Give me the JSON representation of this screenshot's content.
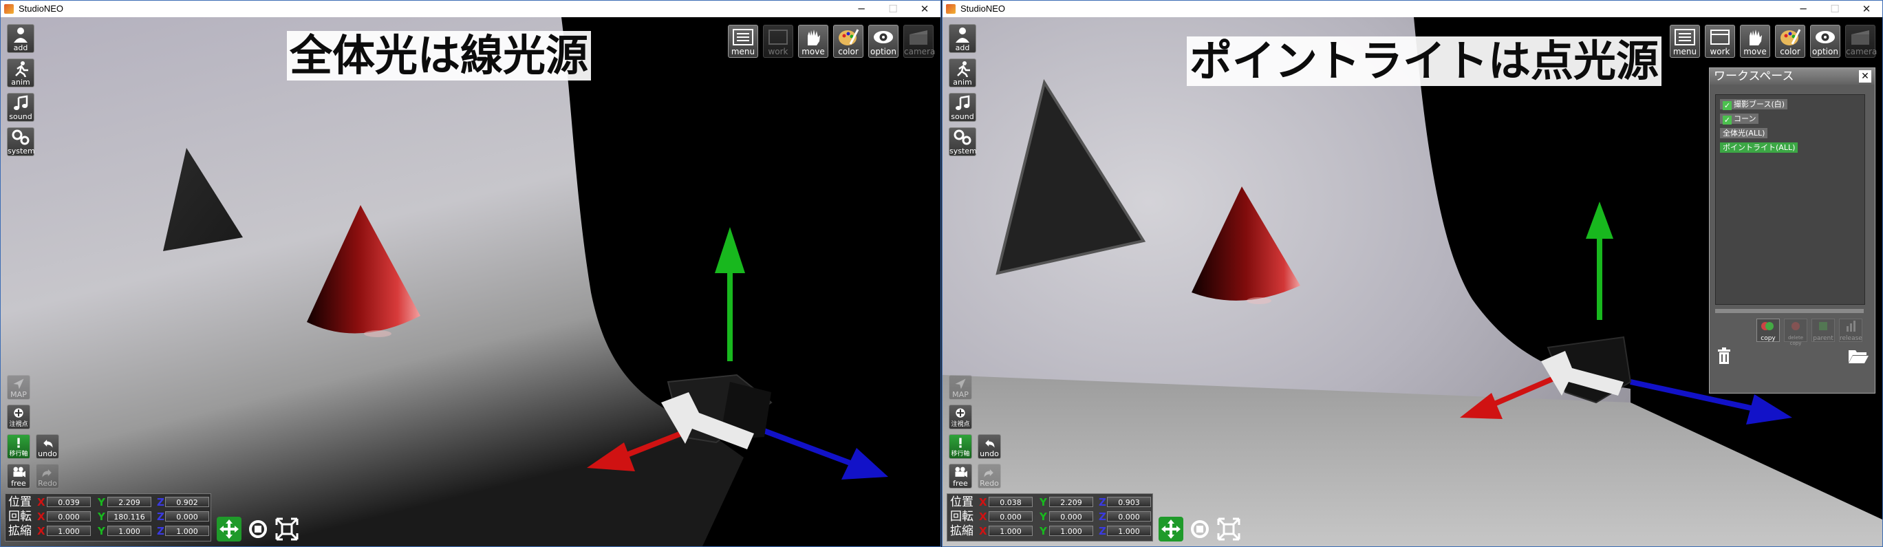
{
  "left": {
    "window_title": "StudioNEO",
    "caption": "全体光は線光源",
    "toolbar": [
      {
        "label": "menu",
        "icon": "menu-icon",
        "enabled": true
      },
      {
        "label": "work",
        "icon": "work-icon",
        "enabled": false
      },
      {
        "label": "move",
        "icon": "hand-icon",
        "enabled": true
      },
      {
        "label": "color",
        "icon": "palette-icon",
        "enabled": true
      },
      {
        "label": "option",
        "icon": "eye-icon",
        "enabled": true
      },
      {
        "label": "camera",
        "icon": "camera-icon",
        "enabled": false
      }
    ],
    "side_top": [
      {
        "label": "add",
        "icon": "person-icon"
      },
      {
        "label": "anim",
        "icon": "running-icon"
      },
      {
        "label": "sound",
        "icon": "music-note-icon"
      },
      {
        "label": "system",
        "icon": "gears-icon"
      }
    ],
    "side_bottom": {
      "map": "MAP",
      "focus": "注視点",
      "axis": "移行軸",
      "undo": "undo",
      "free": "free",
      "redo": "Redo"
    },
    "coords": [
      {
        "label": "位置",
        "x": "0.039",
        "y": "2.209",
        "z": "0.902"
      },
      {
        "label": "回転",
        "x": "0.000",
        "y": "180.116",
        "z": "0.000"
      },
      {
        "label": "拡縮",
        "x": "1.000",
        "y": "1.000",
        "z": "1.000"
      }
    ]
  },
  "right": {
    "window_title": "StudioNEO",
    "caption": "ポイントライトは点光源",
    "toolbar": [
      {
        "label": "menu",
        "icon": "menu-icon",
        "enabled": true
      },
      {
        "label": "work",
        "icon": "work-icon",
        "enabled": true
      },
      {
        "label": "move",
        "icon": "hand-icon",
        "enabled": true
      },
      {
        "label": "color",
        "icon": "palette-icon",
        "enabled": true
      },
      {
        "label": "option",
        "icon": "eye-icon",
        "enabled": true
      },
      {
        "label": "camera",
        "icon": "camera-icon",
        "enabled": false
      }
    ],
    "side_top": [
      {
        "label": "add",
        "icon": "person-icon"
      },
      {
        "label": "anim",
        "icon": "running-icon"
      },
      {
        "label": "sound",
        "icon": "music-note-icon"
      },
      {
        "label": "system",
        "icon": "gears-icon"
      }
    ],
    "side_bottom": {
      "map": "MAP",
      "focus": "注視点",
      "axis": "移行軸",
      "undo": "undo",
      "free": "free",
      "redo": "Redo"
    },
    "coords": [
      {
        "label": "位置",
        "x": "0.038",
        "y": "2.209",
        "z": "0.903"
      },
      {
        "label": "回転",
        "x": "0.000",
        "y": "0.000",
        "z": "0.000"
      },
      {
        "label": "拡縮",
        "x": "1.000",
        "y": "1.000",
        "z": "1.000"
      }
    ],
    "workspace": {
      "title": "ワークスペース",
      "close": "✕",
      "items": [
        {
          "label": "撮影ブース(白)",
          "checked": true,
          "style": "gray"
        },
        {
          "label": "コーン",
          "checked": true,
          "style": "gray"
        },
        {
          "label": "全体光(ALL)",
          "checked": false,
          "style": "gray"
        },
        {
          "label": "ポイントライト(ALL)",
          "checked": false,
          "style": "green"
        }
      ],
      "buttons": [
        "copy",
        "delete copy",
        "parent",
        "release"
      ]
    }
  },
  "colors": {
    "axis_x": "#d01212",
    "axis_y": "#18b81e",
    "axis_z": "#1212c8",
    "checked_green": "#4cc04f",
    "selected_green": "#3ca745"
  }
}
